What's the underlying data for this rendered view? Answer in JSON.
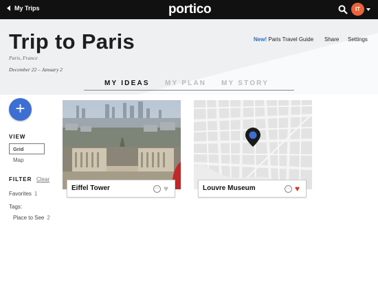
{
  "topbar": {
    "back_label": "My Trips",
    "logo": "portico",
    "avatar_initials": "IT",
    "search_icon": "search-icon"
  },
  "trip": {
    "title": "Trip to Paris",
    "location": "Paris, France",
    "dates": "December 22 – January 2"
  },
  "header_links": {
    "new_badge": "New!",
    "guide": "Paris Travel Guide",
    "share": "Share",
    "settings": "Settings"
  },
  "tabs": [
    {
      "label": "MY IDEAS",
      "active": true
    },
    {
      "label": "MY PLAN",
      "active": false
    },
    {
      "label": "MY STORY",
      "active": false
    }
  ],
  "sidebar": {
    "add_icon": "plus-icon",
    "view_heading": "VIEW",
    "view_options": [
      "Grid",
      "Map"
    ],
    "view_selected": "Grid",
    "filter_heading": "FILTER",
    "clear_label": "Clear",
    "favorites_label": "Favorites",
    "favorites_count": "1",
    "tags_heading": "Tags:",
    "tag_label": "Place to See",
    "tag_count": "2"
  },
  "cards": [
    {
      "name": "Eiffel Tower",
      "favorited": false,
      "image": "photo"
    },
    {
      "name": "Louvre Museum",
      "favorited": true,
      "image": "map"
    }
  ],
  "colors": {
    "accent": "#3c6fd1",
    "heart_active": "#d23a2a",
    "heart_inactive": "#bbbbbb",
    "avatar": "#e8643c"
  }
}
